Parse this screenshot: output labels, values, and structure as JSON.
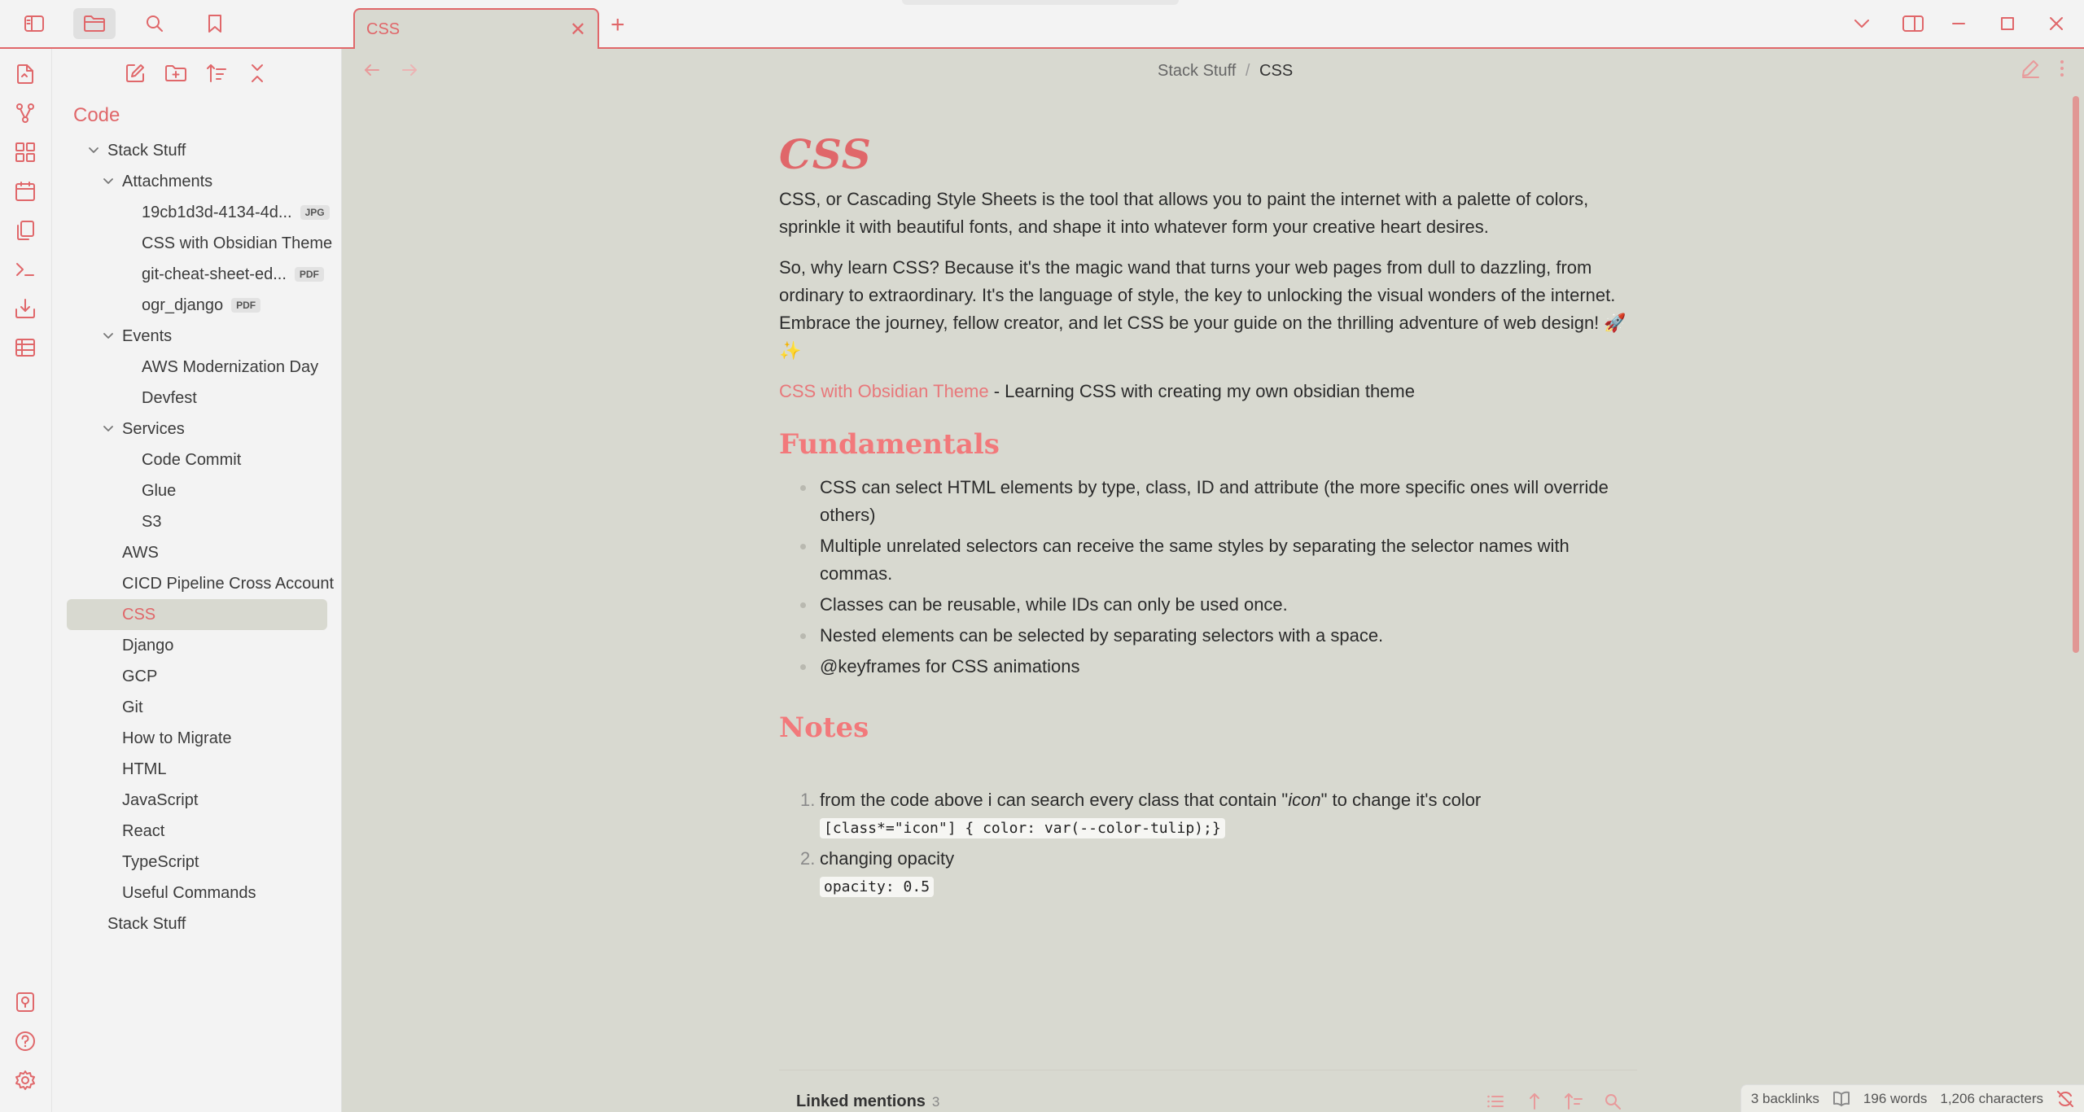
{
  "tab": {
    "title": "CSS"
  },
  "breadcrumb": {
    "folder": "Stack Stuff",
    "separator": "/",
    "current": "CSS"
  },
  "sidebar": {
    "vault_name": "Code",
    "tree": [
      {
        "label": "Stack Stuff",
        "level": 0,
        "folder": true
      },
      {
        "label": "Attachments",
        "level": 1,
        "folder": true
      },
      {
        "label": "19cb1d3d-4134-4d...",
        "level": 2,
        "badge": "JPG"
      },
      {
        "label": "CSS with Obsidian Theme",
        "level": 2
      },
      {
        "label": "git-cheat-sheet-ed...",
        "level": 2,
        "badge": "PDF"
      },
      {
        "label": "ogr_django",
        "level": 2,
        "badge": "PDF"
      },
      {
        "label": "Events",
        "level": 1,
        "folder": true
      },
      {
        "label": "AWS Modernization Day",
        "level": 2
      },
      {
        "label": "Devfest",
        "level": 2
      },
      {
        "label": "Services",
        "level": 1,
        "folder": true
      },
      {
        "label": "Code Commit",
        "level": 2
      },
      {
        "label": "Glue",
        "level": 2
      },
      {
        "label": "S3",
        "level": 2
      },
      {
        "label": "AWS",
        "level": 1
      },
      {
        "label": "CICD Pipeline Cross Account",
        "level": 1
      },
      {
        "label": "CSS",
        "level": 1,
        "active": true
      },
      {
        "label": "Django",
        "level": 1
      },
      {
        "label": "GCP",
        "level": 1
      },
      {
        "label": "Git",
        "level": 1
      },
      {
        "label": "How to Migrate",
        "level": 1
      },
      {
        "label": "HTML",
        "level": 1
      },
      {
        "label": "JavaScript",
        "level": 1
      },
      {
        "label": "React",
        "level": 1
      },
      {
        "label": "TypeScript",
        "level": 1
      },
      {
        "label": "Useful Commands",
        "level": 1
      },
      {
        "label": "Stack Stuff",
        "level": 0
      }
    ]
  },
  "note": {
    "title": "CSS",
    "intro": "CSS, or Cascading Style Sheets is the tool that allows you to paint the internet with a palette of colors, sprinkle it with beautiful fonts, and shape it into whatever form your creative heart desires.",
    "why": "So, why learn CSS? Because it's the magic wand that turns your web pages from dull to dazzling, from ordinary to extraordinary. It's the language of style, the key to unlocking the visual wonders of the internet. Embrace the journey, fellow creator, and let CSS be your guide on the thrilling adventure of web design! 🚀 ✨",
    "link_text": "CSS with Obsidian Theme",
    "link_suffix": " - Learning CSS with creating my own obsidian theme",
    "fundamentals_heading": "Fundamentals",
    "fundamentals": [
      "CSS can select HTML elements by type, class, ID and attribute (the more specific ones will override others)",
      "Multiple unrelated selectors can receive the same styles by separating the selector names with commas.",
      "Classes can be reusable, while IDs can only be used once.",
      "Nested elements can be selected by separating selectors with a space.",
      "@keyframes for CSS animations"
    ],
    "notes_heading": "Notes",
    "notes": [
      {
        "num": "1.",
        "before": "from the code above i can search every class that contain \"",
        "em": "icon",
        "after": "\" to change it's color",
        "code": "[class*=\"icon\"] { color: var(--color-tulip);}"
      },
      {
        "num": "2.",
        "before": "changing opacity",
        "em": "",
        "after": "",
        "code": "opacity: 0.5"
      }
    ]
  },
  "linked_mentions": {
    "label": "Linked mentions",
    "count": "3"
  },
  "status": {
    "backlinks": "3 backlinks",
    "words": "196 words",
    "characters": "1,206 characters"
  },
  "colors": {
    "accent": "#e0676a",
    "background": "#d8d9d0",
    "panel": "#f3f3f3",
    "heading": "#f2797b"
  }
}
